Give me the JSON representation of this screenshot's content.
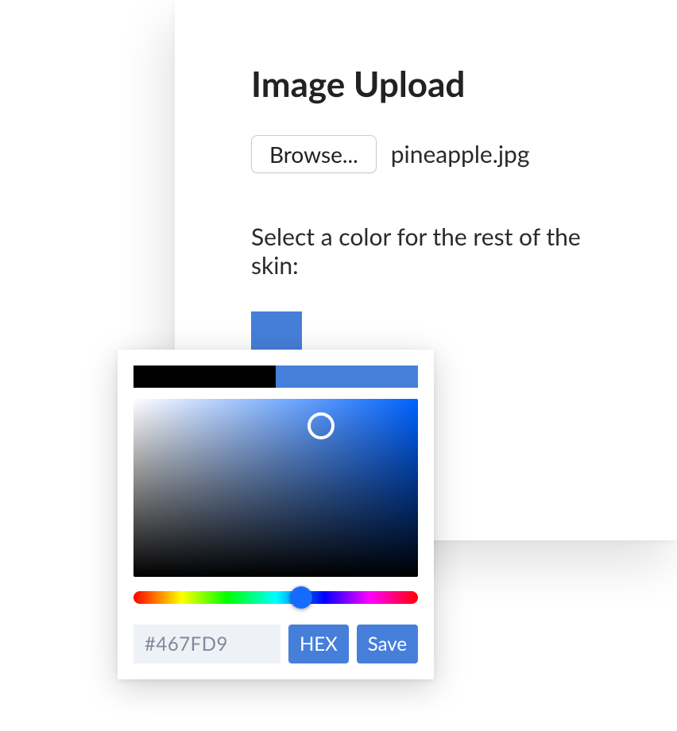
{
  "upload": {
    "title": "Image Upload",
    "browse_label": "Browse...",
    "file_name": "pineapple.jpg",
    "color_prompt": "Select a color for the rest of the skin:",
    "swatch_color": "#467fd9"
  },
  "picker": {
    "hex_value": "#467FD9",
    "hex_label": "HEX",
    "save_label": "Save",
    "hue": 218,
    "base_hue_color": "#0062ff"
  }
}
